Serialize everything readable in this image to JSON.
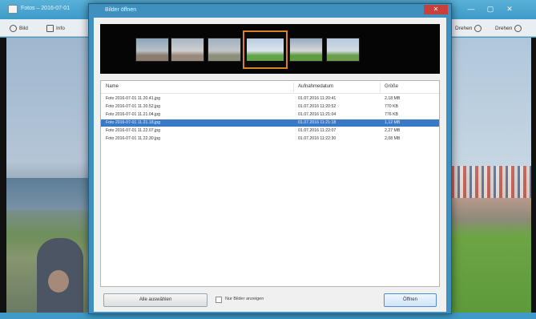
{
  "background_window": {
    "title": "Fotos – 2016-07-01",
    "toolbar": [
      {
        "label": "Bild",
        "icon": "edit-icon"
      },
      {
        "label": "Info",
        "icon": "info-icon"
      },
      {
        "label": "Drehen",
        "icon": "rotate-icon"
      },
      {
        "label": "Drehen",
        "icon": "rotate-icon"
      }
    ],
    "controls": [
      "—",
      "▢",
      "✕"
    ]
  },
  "dialog": {
    "title": "Bilder öffnen",
    "close_glyph": "✕",
    "thumbnails": [
      {
        "colors": [
          "#8da3b8",
          "#b9c2c8",
          "#8a7d6e"
        ]
      },
      {
        "colors": [
          "#a8b5c2",
          "#cfcfcf",
          "#9a8a7d"
        ]
      },
      {
        "colors": [
          "#9fb0c0",
          "#c3c6c9",
          "#8c8f7a"
        ]
      },
      {
        "colors": [
          "#b7cbe0",
          "#dbe5ee",
          "#62a34a"
        ],
        "selected": true
      },
      {
        "colors": [
          "#95a9bd",
          "#d8d8d8",
          "#5f9c42"
        ]
      },
      {
        "colors": [
          "#b6c9dc",
          "#d3dce4",
          "#6a9e4c"
        ]
      }
    ],
    "columns": [
      "Name",
      "Aufnahmedatum",
      "Größe"
    ],
    "files": [
      {
        "name": "Foto 2016-07-01 11.20.41.jpg",
        "date": "01.07.2016 11:20:41",
        "size": "2,18 MB"
      },
      {
        "name": "Foto 2016-07-01 11.20.52.jpg",
        "date": "01.07.2016 11:20:52",
        "size": "770 KB"
      },
      {
        "name": "Foto 2016-07-01 11.21.04.jpg",
        "date": "01.07.2016 11:21:04",
        "size": "776 KB"
      },
      {
        "name": "Foto 2016-07-01 11.21.18.jpg",
        "date": "01.07.2016 11:21:18",
        "size": "1,12 MB",
        "selected": true
      },
      {
        "name": "Foto 2016-07-01 11.22.07.jpg",
        "date": "01.07.2016 11:22:07",
        "size": "2,27 MB"
      },
      {
        "name": "Foto 2016-07-01 11.22.30.jpg",
        "date": "01.07.2016 11:22:30",
        "size": "2,08 MB"
      }
    ],
    "left_button": "Alle auswählen",
    "checkbox_label": "Nur Bilder anzeigen",
    "ok_button": "Öffnen"
  }
}
